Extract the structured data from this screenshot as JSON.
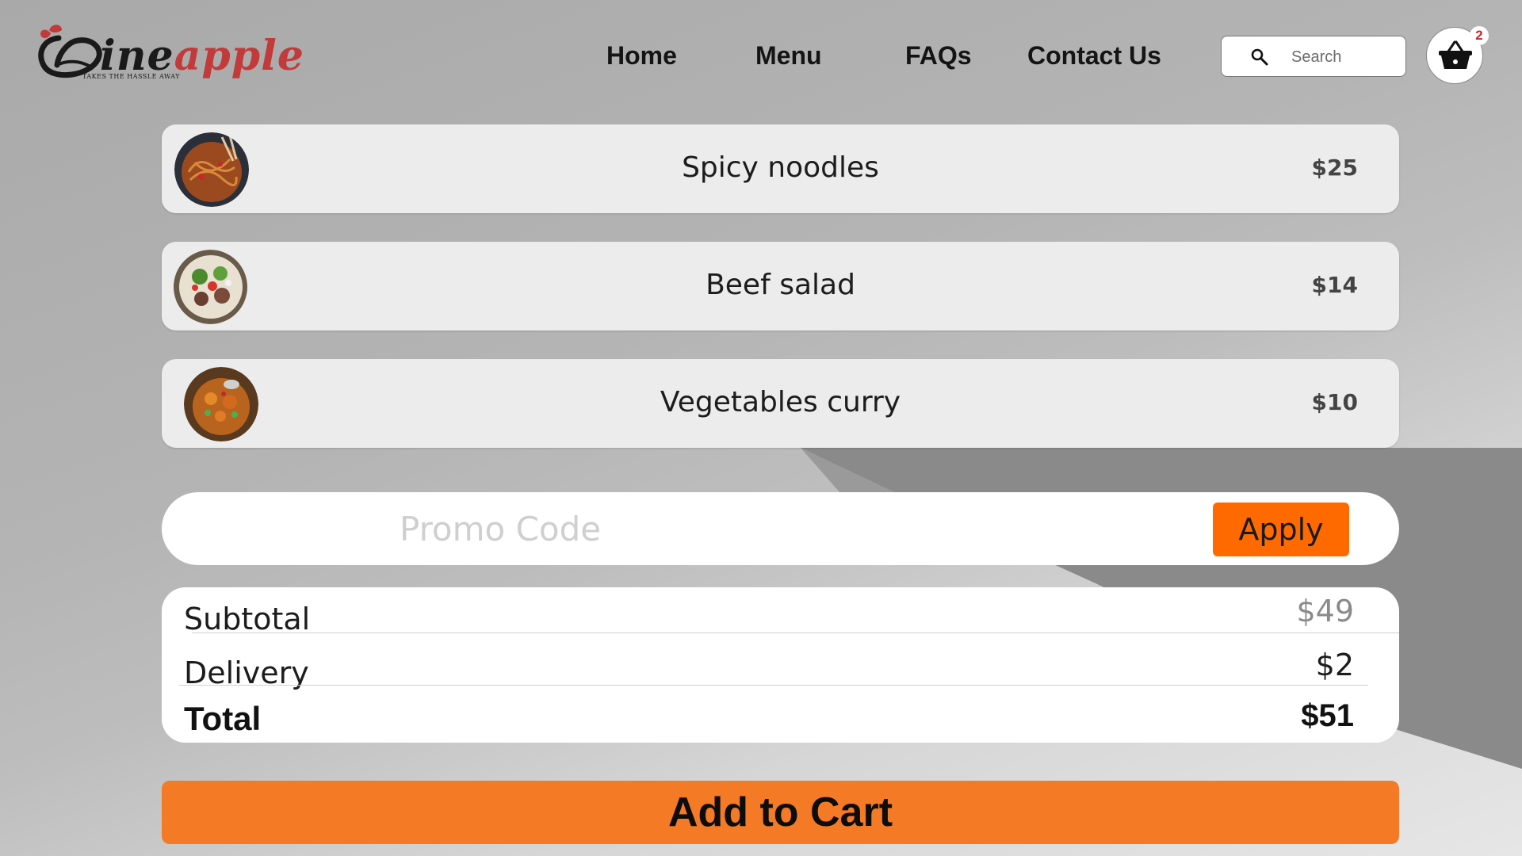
{
  "brand": {
    "logo_letter": "D",
    "logo_rest_dark": "ine",
    "logo_rest_red": "apple",
    "tagline": "TAKES THE HASSLE AWAY",
    "primary_color": "#c23a3a"
  },
  "nav": {
    "items": [
      {
        "label": "Home"
      },
      {
        "label": "Menu"
      },
      {
        "label": "FAQs"
      },
      {
        "label": "Contact Us"
      }
    ]
  },
  "search": {
    "placeholder": "Search",
    "value": "",
    "icon": "search-icon"
  },
  "cart": {
    "icon": "basket-icon",
    "count": "2"
  },
  "items": [
    {
      "name": "Spicy noodles",
      "price": "$25",
      "image": "noodles-photo"
    },
    {
      "name": "Beef salad",
      "price": "$14",
      "image": "salad-photo"
    },
    {
      "name": "Vegetables curry",
      "price": "$10",
      "image": "curry-photo"
    }
  ],
  "promo": {
    "placeholder": "Promo Code",
    "value": "",
    "apply_label": "Apply",
    "apply_color": "#ff6a00"
  },
  "summary": {
    "subtotal_label": "Subtotal",
    "subtotal_value": "$49",
    "delivery_label": "Delivery",
    "delivery_value": "$2",
    "total_label": "Total",
    "total_value": "$51"
  },
  "add_to_cart": {
    "label": "Add to Cart",
    "color": "#f47a25"
  }
}
